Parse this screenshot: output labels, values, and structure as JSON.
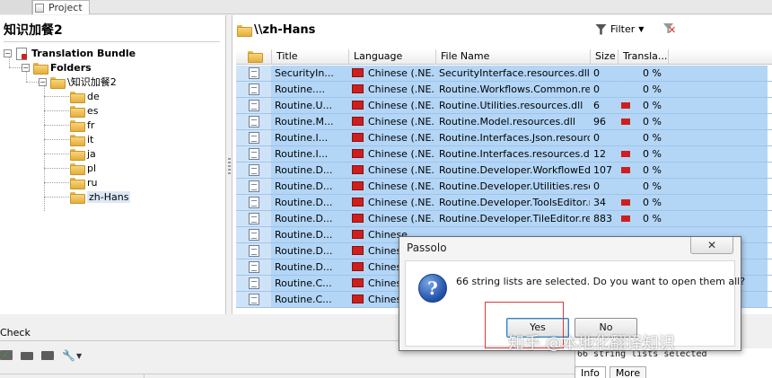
{
  "top": {
    "project_tab": "Project"
  },
  "left": {
    "title": "知识加餐2",
    "tree": {
      "bundle": "Translation Bundle",
      "folders": "Folders",
      "project_folder": "\\知识加餐2",
      "languages": [
        "de",
        "es",
        "fr",
        "it",
        "ja",
        "pl",
        "ru",
        "zh-Hans"
      ]
    }
  },
  "right": {
    "path": "\\\\zh-Hans",
    "filter_label": "Filter",
    "columns": [
      "",
      "Title",
      "Language",
      "File Name",
      "Size",
      "Transla..."
    ],
    "rows": [
      {
        "title": "SecurityIn...",
        "language": "Chinese (.NE...",
        "file": "SecurityInterface.resources.dll",
        "size": "0",
        "percent": "0 %",
        "bar": false
      },
      {
        "title": "Routine....",
        "language": "Chinese (.NE...",
        "file": "Routine.Workflows.Common.resou",
        "size": "0",
        "percent": "0 %",
        "bar": false
      },
      {
        "title": "Routine.U...",
        "language": "Chinese (.NE...",
        "file": "Routine.Utilities.resources.dll",
        "size": "6",
        "percent": "0 %",
        "bar": true
      },
      {
        "title": "Routine.M...",
        "language": "Chinese (.NE...",
        "file": "Routine.Model.resources.dll",
        "size": "96",
        "percent": "0 %",
        "bar": true
      },
      {
        "title": "Routine.I...",
        "language": "Chinese (.NE...",
        "file": "Routine.Interfaces.Json.resources",
        "size": "0",
        "percent": "0 %",
        "bar": false
      },
      {
        "title": "Routine.I...",
        "language": "Chinese (.NE...",
        "file": "Routine.Interfaces.resources.dll",
        "size": "12",
        "percent": "0 %",
        "bar": true
      },
      {
        "title": "Routine.D...",
        "language": "Chinese (.NE...",
        "file": "Routine.Developer.WorkflowEditor",
        "size": "107",
        "percent": "0 %",
        "bar": true
      },
      {
        "title": "Routine.D...",
        "language": "Chinese (.NE...",
        "file": "Routine.Developer.Utilities.resourc",
        "size": "0",
        "percent": "0 %",
        "bar": false
      },
      {
        "title": "Routine.D...",
        "language": "Chinese (.NE...",
        "file": "Routine.Developer.ToolsEditor.resc",
        "size": "34",
        "percent": "0 %",
        "bar": true
      },
      {
        "title": "Routine.D...",
        "language": "Chinese (.NE...",
        "file": "Routine.Developer.TileEditor.resou",
        "size": "883",
        "percent": "0 %",
        "bar": true
      },
      {
        "title": "Routine.D...",
        "language": "Chinese",
        "file": "",
        "size": "",
        "percent": "",
        "bar": false
      },
      {
        "title": "Routine.D...",
        "language": "Chinese",
        "file": "",
        "size": "",
        "percent": "",
        "bar": false
      },
      {
        "title": "Routine.D...",
        "language": "Chinese",
        "file": "",
        "size": "",
        "percent": "",
        "bar": false
      },
      {
        "title": "Routine.C...",
        "language": "Chinese",
        "file": "",
        "size": "",
        "percent": "",
        "bar": false
      },
      {
        "title": "Routine.C...",
        "language": "Chinese",
        "file": "",
        "size": "",
        "percent": "",
        "bar": false
      }
    ]
  },
  "bottom": {
    "check_title": "Check",
    "log_text": "66 string lists selected",
    "tabs": [
      "Info",
      "More"
    ]
  },
  "dialog": {
    "title": "Passolo",
    "close_glyph": "✕",
    "message": "66 string lists are selected. Do you want to open them all?",
    "yes_label": "Yes",
    "no_label": "No"
  },
  "watermark": "知乎 @本地化翻译知识"
}
